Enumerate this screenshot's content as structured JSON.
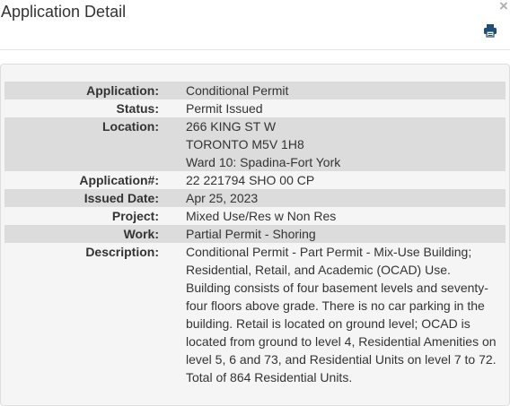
{
  "header": {
    "title": "Application Detail",
    "close_label": "×",
    "print_icon": "printer-icon"
  },
  "details": [
    {
      "label": "Application:",
      "lines": [
        "Conditional Permit"
      ]
    },
    {
      "label": "Status:",
      "lines": [
        "Permit Issued"
      ]
    },
    {
      "label": "Location:",
      "lines": [
        "266 KING ST W",
        "TORONTO M5V 1H8",
        "Ward 10: Spadina-Fort York"
      ]
    },
    {
      "label": "Application#:",
      "lines": [
        "22 221794 SHO 00 CP"
      ]
    },
    {
      "label": "Issued Date:",
      "lines": [
        "Apr 25, 2023"
      ]
    },
    {
      "label": "Project:",
      "lines": [
        "Mixed Use/Res w Non Res"
      ]
    },
    {
      "label": "Work:",
      "lines": [
        "Partial Permit - Shoring"
      ]
    },
    {
      "label": "Description:",
      "lines": [
        "Conditional Permit - Part Permit - Mix-Use Building; Residential, Retail, and Academic (OCAD) Use. Building consists of four basement levels and seventy-four floors above grade. There is no car parking in the building. Retail is located on ground level; OCAD is located from ground to level 4, Residential Amenities on level 5, 6 and 73, and Residential Units on level 7 to 72. Total of 864 Residential Units."
      ]
    }
  ]
}
